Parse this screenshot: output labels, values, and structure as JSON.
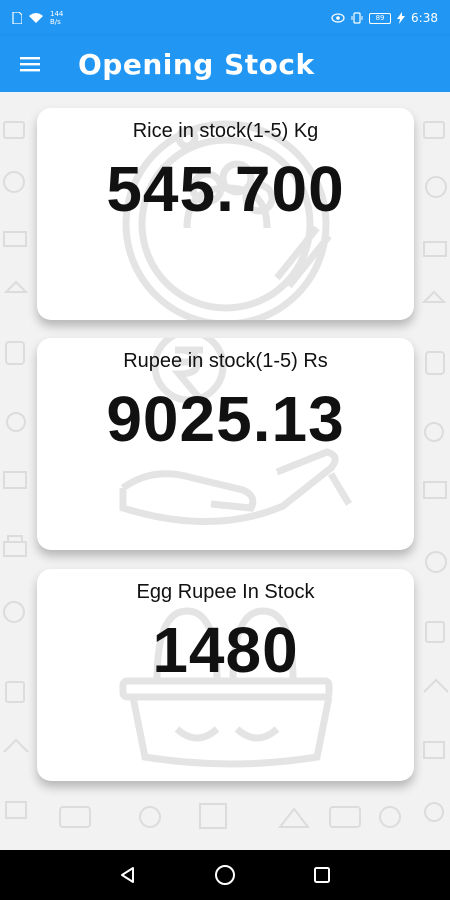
{
  "status_bar": {
    "speed_value": "144",
    "speed_unit": "B/s",
    "battery": "89",
    "time": "6:38"
  },
  "app_bar": {
    "title": "Opening Stock"
  },
  "cards": [
    {
      "label": "Rice in stock(1-5)  Kg",
      "value": "545.700"
    },
    {
      "label": "Rupee in stock(1-5)  Rs",
      "value": "9025.13"
    },
    {
      "label": "Egg Rupee In Stock",
      "value": "1480"
    }
  ],
  "colors": {
    "primary": "#2196f3",
    "background": "#f2f2f2",
    "card": "#ffffff",
    "nav": "#000000"
  }
}
